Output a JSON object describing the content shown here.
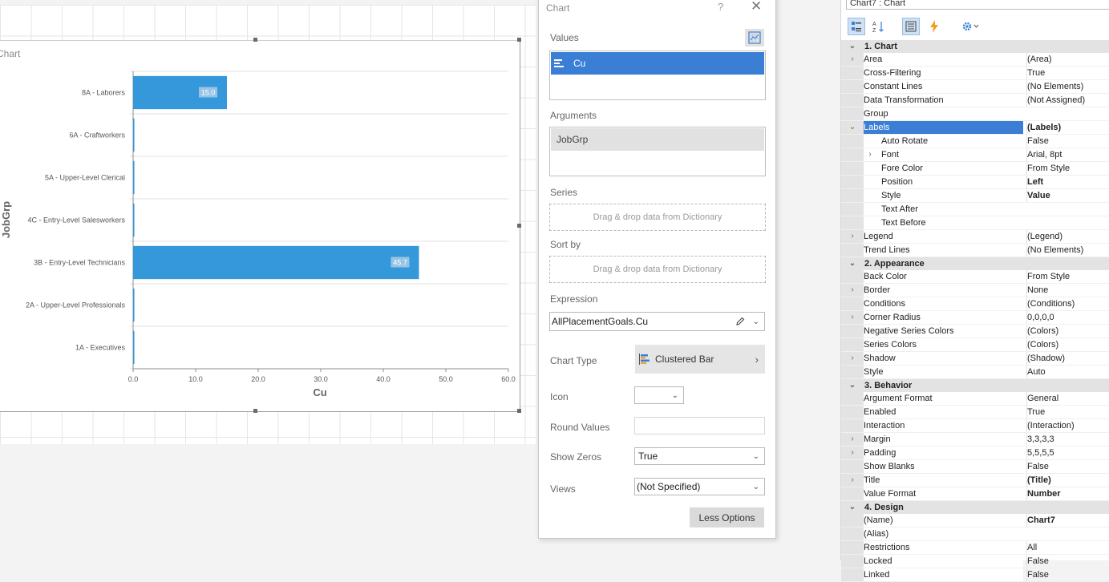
{
  "chart": {
    "title": "Chart",
    "chart_data": {
      "type": "bar",
      "orientation": "horizontal",
      "categories": [
        "8A - Laborers",
        "6A - Craftworkers",
        "5A - Upper-Level Clerical",
        "4C - Entry-Level Salesworkers",
        "3B - Entry-Level Technicians",
        "2A - Upper-Level Professionals",
        "1A - Executives"
      ],
      "values": [
        15.0,
        0.2,
        0.2,
        0.2,
        45.7,
        0.2,
        0.2
      ],
      "data_labels": [
        "15.0",
        "",
        "",
        "",
        "45.7",
        "",
        ""
      ],
      "xlabel": "Cu",
      "ylabel": "JobGrp",
      "xlim": [
        0,
        60
      ],
      "xticks": [
        "0.0",
        "10.0",
        "20.0",
        "30.0",
        "40.0",
        "50.0",
        "60.0"
      ],
      "bar_color": "#3498db",
      "grid": true
    }
  },
  "dialog": {
    "title": "Chart",
    "help": "?",
    "close": "✕",
    "values_label": "Values",
    "values_item": "Cu",
    "arguments_label": "Arguments",
    "arguments_item": "JobGrp",
    "series_label": "Series",
    "series_placeholder": "Drag & drop data from Dictionary",
    "sortby_label": "Sort by",
    "sortby_placeholder": "Drag & drop data from Dictionary",
    "expression_label": "Expression",
    "expression_value": "AllPlacementGoals.Cu",
    "charttype_label": "Chart Type",
    "charttype_value": "Clustered Bar",
    "icon_label": "Icon",
    "roundvalues_label": "Round Values",
    "showzeros_label": "Show Zeros",
    "showzeros_value": "True",
    "views_label": "Views",
    "views_value": "(Not Specified)",
    "less_options": "Less Options"
  },
  "props": {
    "path": "Chart7 : Chart",
    "rows": [
      {
        "kind": "cat",
        "exp": "⌄",
        "name": "1. Chart"
      },
      {
        "exp": "›",
        "name": "Area",
        "value": "(Area)"
      },
      {
        "name": "Cross-Filtering",
        "value": "True"
      },
      {
        "name": "Constant Lines",
        "value": "(No Elements)"
      },
      {
        "name": "Data Transformation",
        "value": "(Not Assigned)"
      },
      {
        "name": "Group",
        "value": ""
      },
      {
        "exp": "⌄",
        "name": "Labels",
        "value": "(Labels)",
        "sel": true,
        "bold": true
      },
      {
        "sub": true,
        "name": "Auto Rotate",
        "value": "False"
      },
      {
        "sub": true,
        "exp": "›",
        "name": "Font",
        "value": "Arial, 8pt"
      },
      {
        "sub": true,
        "name": "Fore Color",
        "value": "From Style"
      },
      {
        "sub": true,
        "name": "Position",
        "value": "Left",
        "bold": true
      },
      {
        "sub": true,
        "name": "Style",
        "value": "Value",
        "bold": true
      },
      {
        "sub": true,
        "name": "Text After",
        "value": ""
      },
      {
        "sub": true,
        "name": "Text Before",
        "value": ""
      },
      {
        "exp": "›",
        "name": "Legend",
        "value": "(Legend)"
      },
      {
        "name": "Trend Lines",
        "value": "(No Elements)"
      },
      {
        "kind": "cat",
        "exp": "⌄",
        "name": "2. Appearance"
      },
      {
        "name": "Back Color",
        "value": "From Style"
      },
      {
        "exp": "›",
        "name": "Border",
        "value": "None"
      },
      {
        "name": "Conditions",
        "value": "(Conditions)"
      },
      {
        "exp": "›",
        "name": "Corner Radius",
        "value": "0,0,0,0"
      },
      {
        "name": "Negative Series Colors",
        "value": "(Colors)"
      },
      {
        "name": "Series Colors",
        "value": "(Colors)"
      },
      {
        "exp": "›",
        "name": "Shadow",
        "value": "(Shadow)"
      },
      {
        "name": "Style",
        "value": "Auto"
      },
      {
        "kind": "cat",
        "exp": "⌄",
        "name": "3. Behavior"
      },
      {
        "name": "Argument Format",
        "value": "General"
      },
      {
        "name": "Enabled",
        "value": "True"
      },
      {
        "name": "Interaction",
        "value": "(Interaction)"
      },
      {
        "exp": "›",
        "name": "Margin",
        "value": "3,3,3,3"
      },
      {
        "exp": "›",
        "name": "Padding",
        "value": "5,5,5,5"
      },
      {
        "name": "Show Blanks",
        "value": "False"
      },
      {
        "exp": "›",
        "name": "Title",
        "value": "(Title)",
        "bold": true
      },
      {
        "name": "Value Format",
        "value": "Number",
        "bold": true
      },
      {
        "kind": "cat",
        "exp": "⌄",
        "name": "4. Design"
      },
      {
        "name": "(Name)",
        "value": "Chart7",
        "bold": true
      },
      {
        "name": "(Alias)",
        "value": ""
      },
      {
        "name": "Restrictions",
        "value": "All"
      },
      {
        "name": "Locked",
        "value": "False"
      },
      {
        "name": "Linked",
        "value": "False"
      }
    ]
  }
}
